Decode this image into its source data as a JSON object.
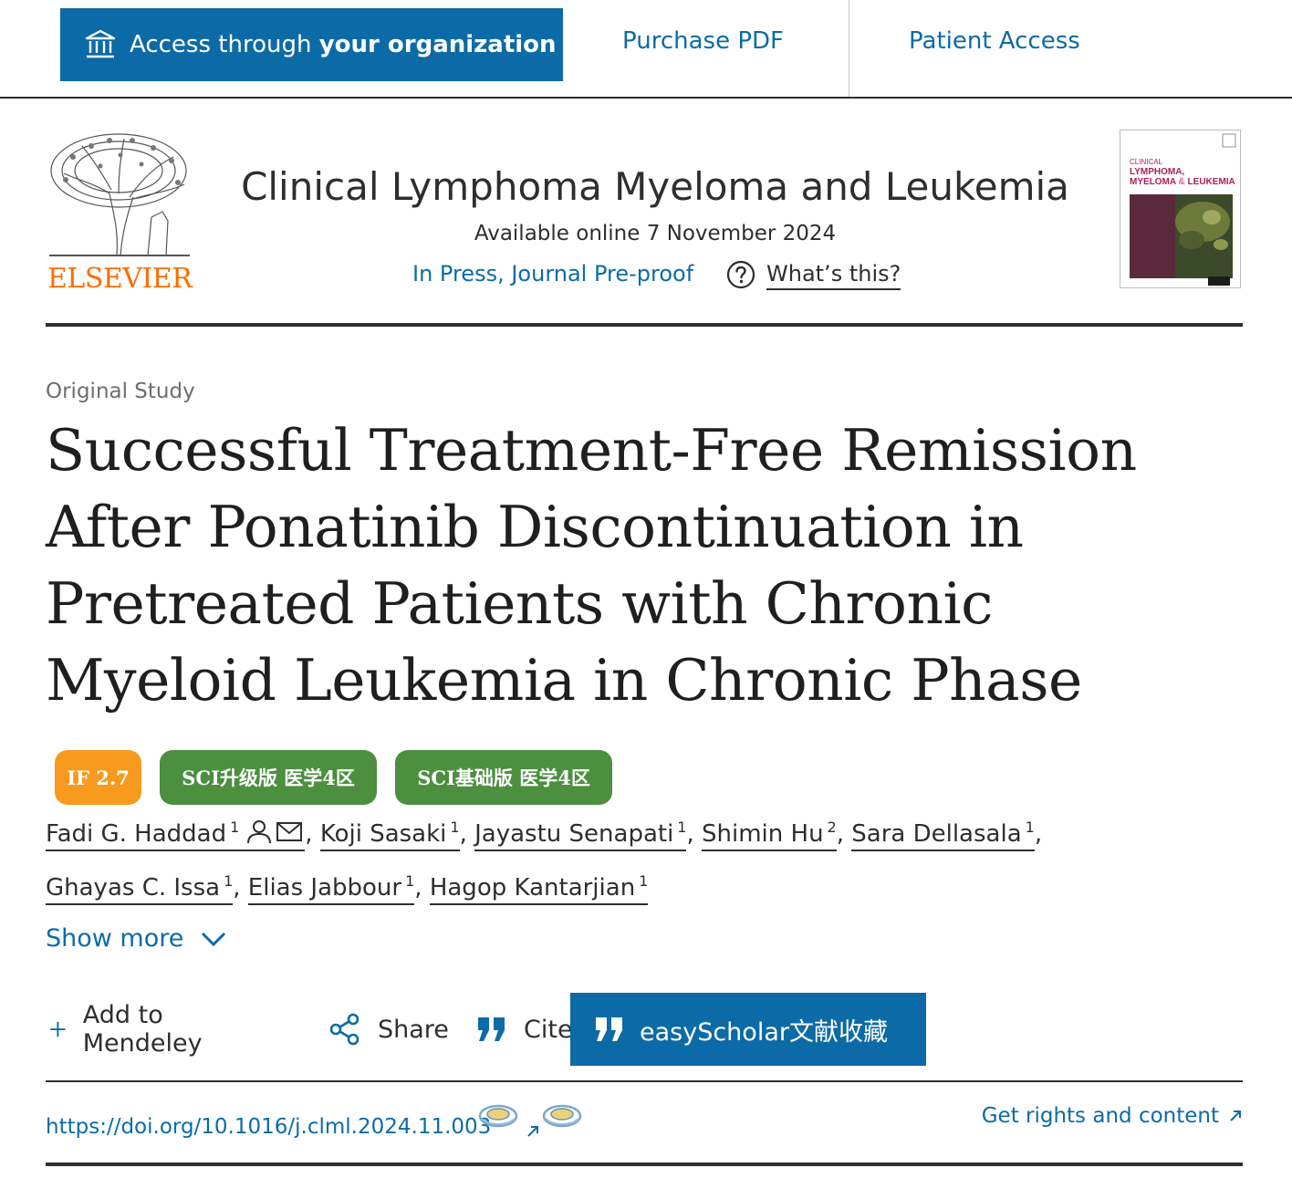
{
  "access_bar": {
    "access_prefix": "Access through ",
    "access_bold": "your organization",
    "purchase_pdf": "Purchase PDF",
    "patient_access": "Patient Access"
  },
  "journal": {
    "publisher": "ELSEVIER",
    "title": "Clinical Lymphoma Myeloma and Leukemia",
    "available": "Available online 7 November 2024",
    "status": "In Press, Journal Pre-proof",
    "whats_this": "What’s this?",
    "cover_small": "CLINICAL",
    "cover_line1": "LYMPHOMA,",
    "cover_line2": "MYELOMA",
    "cover_amp": "&",
    "cover_line3": "LEUKEMIA"
  },
  "article": {
    "type": "Original Study",
    "title": "Successful Treatment-Free Remission After Ponatinib Discontinuation in Pretreated Patients with Chronic Myeloid Leukemia in Chronic Phase"
  },
  "badges": {
    "impact": "IF 2.7",
    "sci_upgrade": "SCI升级版 医学4区",
    "sci_basic": "SCI基础版 医学4区"
  },
  "authors": [
    {
      "name": "Fadi G. Haddad",
      "aff": "1"
    },
    {
      "name": "Koji Sasaki",
      "aff": "1"
    },
    {
      "name": "Jayastu Senapati",
      "aff": "1"
    },
    {
      "name": "Shimin Hu",
      "aff": "2"
    },
    {
      "name": "Sara Dellasala",
      "aff": "1"
    },
    {
      "name": "Ghayas C. Issa",
      "aff": "1"
    },
    {
      "name": "Elias Jabbour",
      "aff": "1"
    },
    {
      "name": "Hagop Kantarjian",
      "aff": "1"
    }
  ],
  "show_more": "Show more",
  "toolbar": {
    "mendeley": "Add to Mendeley",
    "share": "Share",
    "cite": "Cite",
    "easyscholar": "easyScholar文献收藏"
  },
  "doi": {
    "url": "https://doi.org/10.1016/j.clml.2024.11.003",
    "rights": "Get rights and content"
  },
  "colors": {
    "link_blue": "#0c6ba6",
    "elsevier_orange": "#ff6c00",
    "badge_orange": "#f79a1e",
    "badge_green": "#4b8f3f"
  }
}
